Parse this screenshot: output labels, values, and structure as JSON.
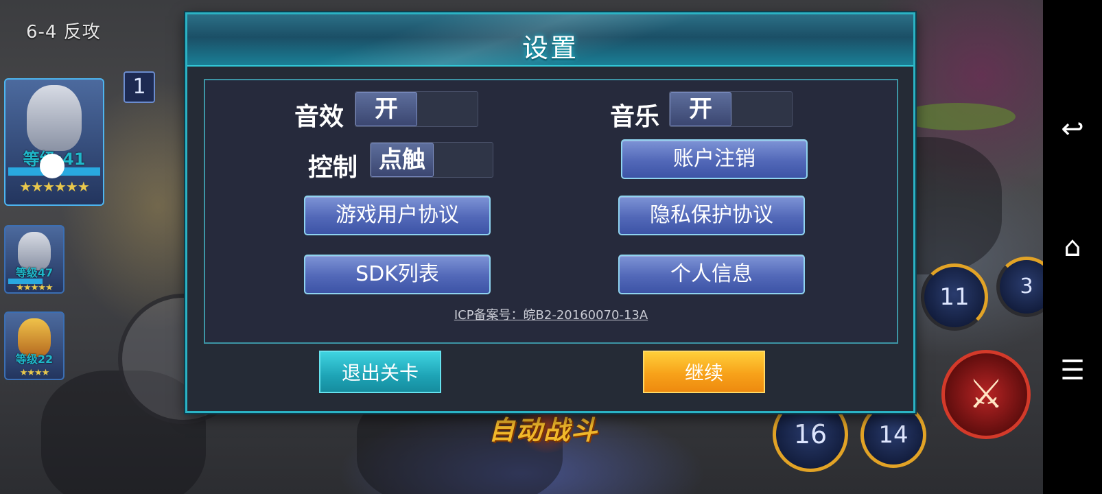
{
  "game": {
    "stage": "6-4 反攻",
    "team_count": "1",
    "heroes": [
      {
        "level": "等级:41",
        "stars": "★★★★★★"
      },
      {
        "level": "等级47",
        "stars": "★★★★★"
      },
      {
        "level": "等级22",
        "stars": "★★★★"
      }
    ],
    "skills": [
      "11",
      "3",
      "16",
      "14"
    ],
    "auto_battle": "自动战斗",
    "ultimate_icon": "crossed-swords-icon"
  },
  "settings": {
    "title": "设置",
    "sound": {
      "label": "音效",
      "value": "开"
    },
    "music": {
      "label": "音乐",
      "value": "开"
    },
    "control": {
      "label": "控制",
      "value": "点触"
    },
    "buttons": {
      "account_logout": "账户注销",
      "user_agreement": "游戏用户协议",
      "privacy_agreement": "隐私保护协议",
      "sdk_list": "SDK列表",
      "personal_info": "个人信息"
    },
    "icp": "ICP备案号：皖B2-20160070-13A",
    "exit_stage": "退出关卡",
    "continue": "继续"
  },
  "navbar": {
    "back": "↩",
    "home": "⌂",
    "menu": "☰"
  },
  "colors": {
    "accent": "#2bb3c4",
    "button_blue": "#5268b8",
    "continue_orange": "#f7a21a",
    "exit_teal": "#1ea4b6"
  }
}
